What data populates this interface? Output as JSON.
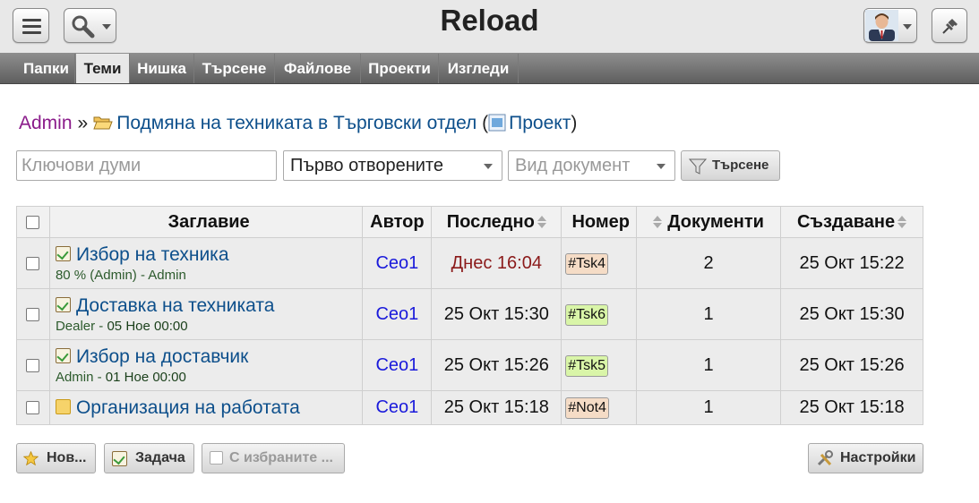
{
  "app": {
    "title": "Reload"
  },
  "tabs": [
    {
      "label": "Папки",
      "active": false
    },
    {
      "label": "Теми",
      "active": true
    },
    {
      "label": "Нишка",
      "active": false
    },
    {
      "label": "Търсене",
      "active": false
    },
    {
      "label": "Файлове",
      "active": false
    },
    {
      "label": "Проекти",
      "active": false
    },
    {
      "label": "Изгледи",
      "active": false
    }
  ],
  "breadcrumb": {
    "user": "Admin",
    "separator": "»",
    "folder": "Подмяна на техниката в Търговски отдел",
    "open_paren": "(",
    "project": "Проект",
    "close_paren": ")"
  },
  "filters": {
    "keywords_placeholder": "Ключови думи",
    "order_value": "Първо отворените",
    "doctype_placeholder": "Вид документ",
    "search_label": "Търсене"
  },
  "table": {
    "columns": [
      "Заглавие",
      "Автор",
      "Последно",
      "Номер",
      "Документи",
      "Създаване"
    ],
    "rows": [
      {
        "title": "Избор на техника",
        "icon": "task-icon",
        "sub_owner": "80 % (Admin) - Admin",
        "sub_due": "",
        "author": "Ceo1",
        "last": "Днес 16:04",
        "number": "#Tsk4",
        "number_color": "#f5dcc6",
        "docs": "2",
        "created": "25 Окт 15:22"
      },
      {
        "title": "Доставка на техниката",
        "icon": "task-icon",
        "sub_owner": "Dealer - ",
        "sub_due": "05 Ное 00:00",
        "author": "Ceo1",
        "last": "25 Окт 15:30",
        "number": "#Tsk6",
        "number_color": "#d9f5a8",
        "docs": "1",
        "created": "25 Окт 15:30"
      },
      {
        "title": "Избор на доставчик",
        "icon": "task-icon",
        "sub_owner": "Admin - ",
        "sub_due": "01 Ное 00:00",
        "author": "Ceo1",
        "last": "25 Окт 15:26",
        "number": "#Tsk5",
        "number_color": "#d9f5a8",
        "docs": "1",
        "created": "25 Окт 15:26"
      },
      {
        "title": "Организация на работата",
        "icon": "note-icon",
        "sub_owner": "",
        "sub_due": "",
        "author": "Ceo1",
        "last": "25 Окт 15:18",
        "number": "#Not4",
        "number_color": "#f5dcc6",
        "docs": "1",
        "created": "25 Окт 15:18"
      }
    ]
  },
  "bottom": {
    "new_label": "Нов...",
    "task_label": "Задача",
    "selected_label": "С избраните ...",
    "settings_label": "Настройки"
  }
}
